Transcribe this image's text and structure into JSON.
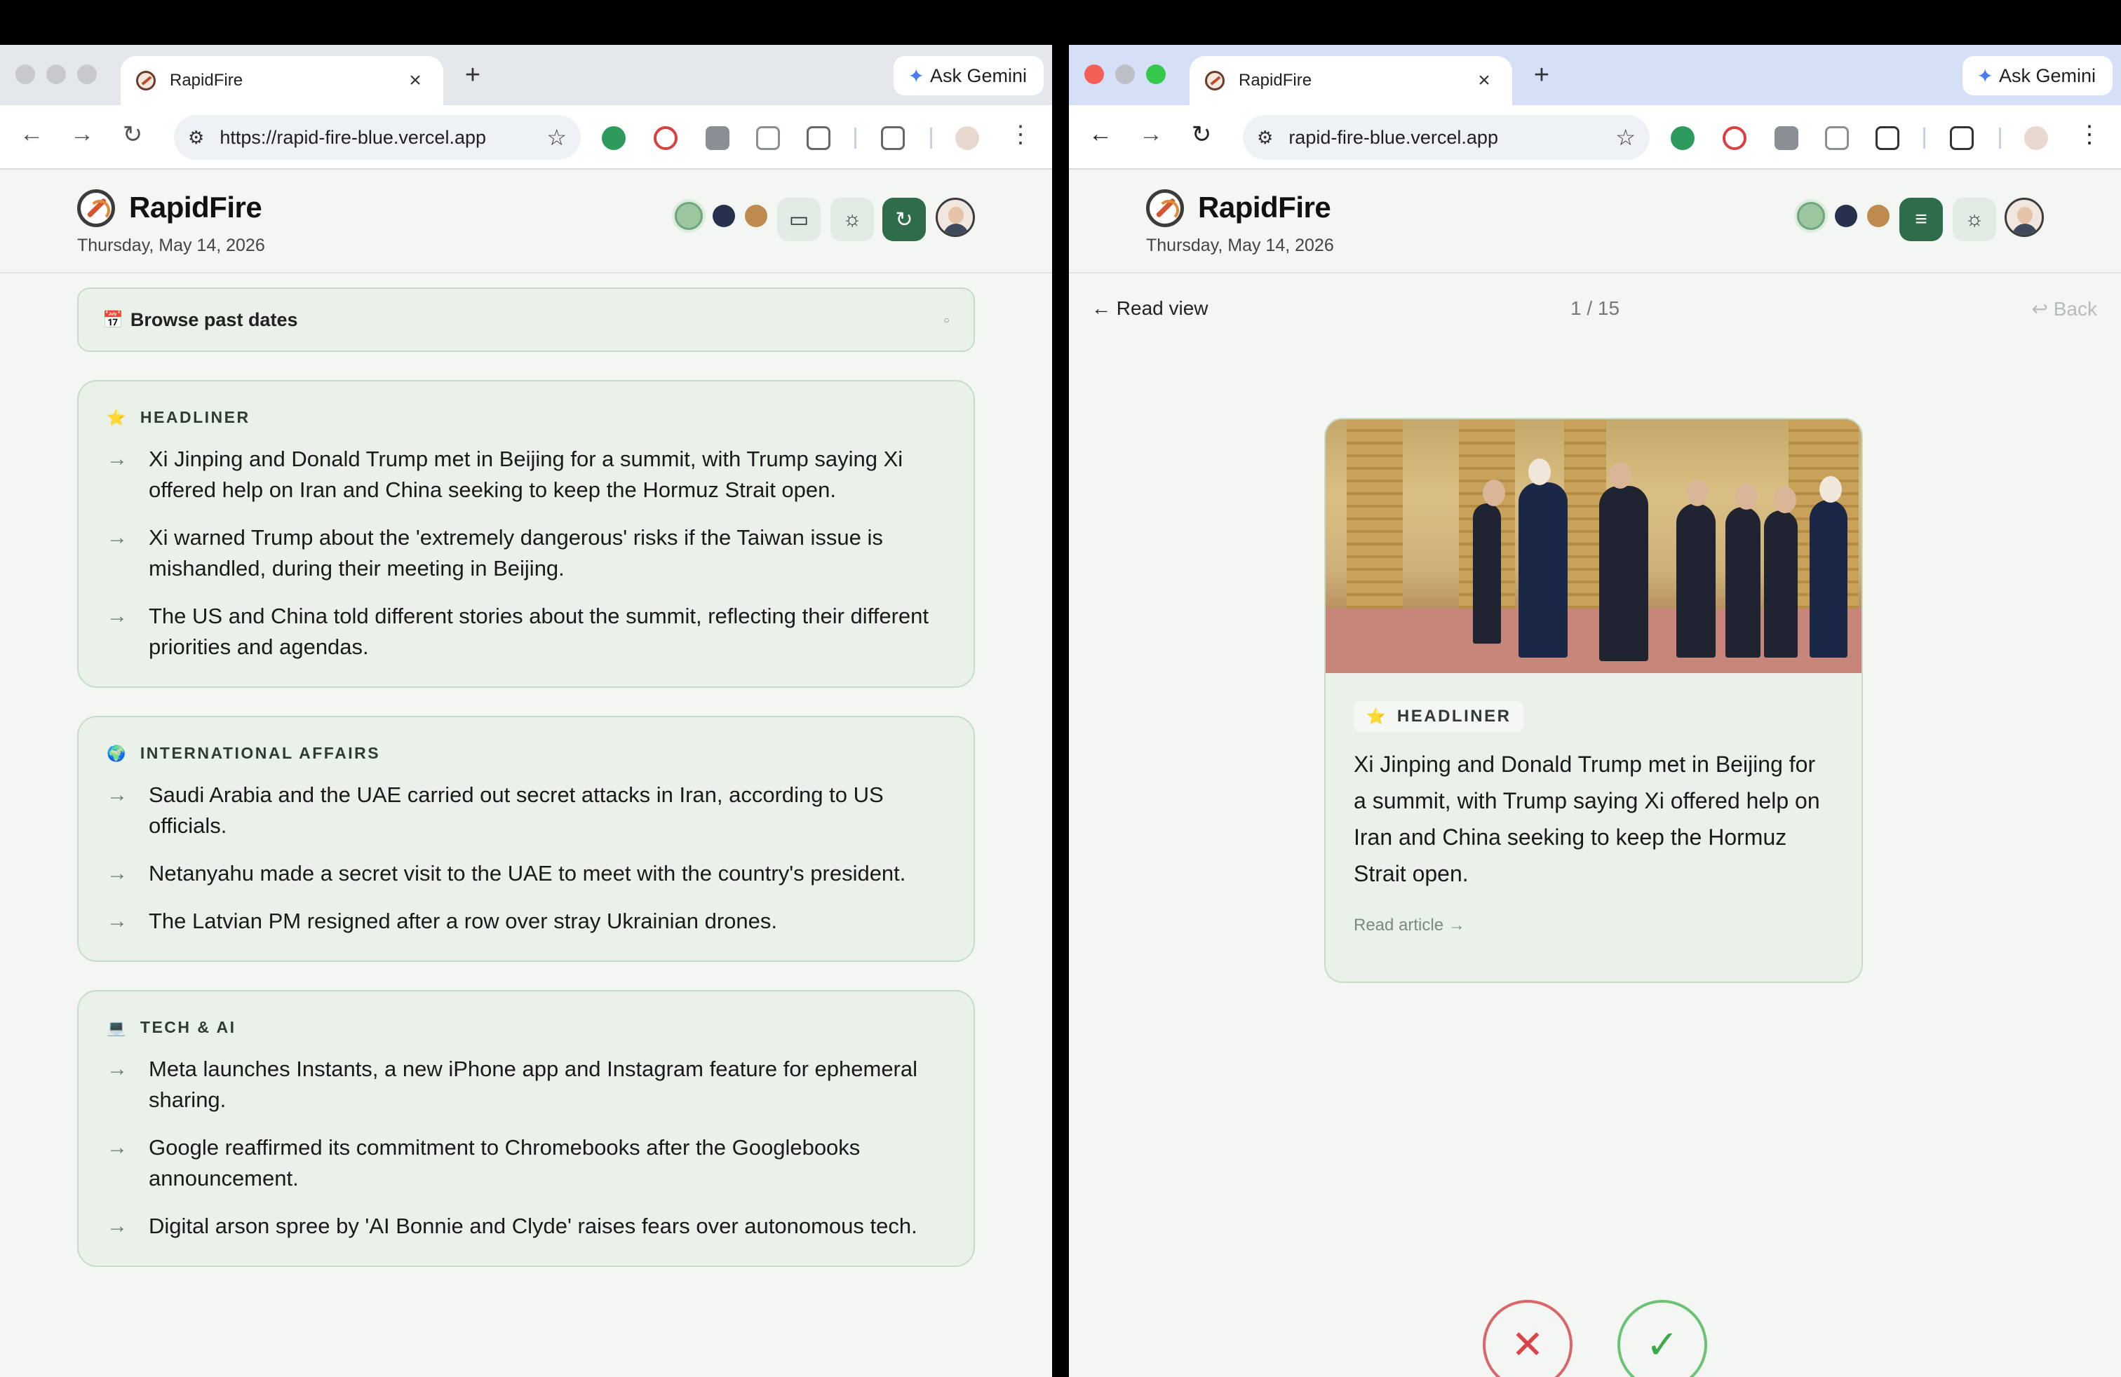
{
  "browser_left": {
    "tab_title": "RapidFire",
    "url": "https://rapid-fire-blue.vercel.app",
    "gemini_label": "Ask Gemini"
  },
  "browser_right": {
    "tab_title": "RapidFire",
    "url": "rapid-fire-blue.vercel.app",
    "gemini_label": "Ask Gemini"
  },
  "app": {
    "brand": "RapidFire",
    "date": "Thursday, May 14, 2026",
    "theme_colors": [
      "#9dc7a1",
      "#26324d",
      "#bf8a4e"
    ]
  },
  "left": {
    "browse_label": "Browse past dates",
    "browse_icon": "calendar-icon",
    "sections": [
      {
        "icon": "⭐",
        "title": "HEADLINER",
        "items": [
          "Xi Jinping and Donald Trump met in Beijing for a summit, with Trump saying Xi offered help on Iran and China seeking to keep the Hormuz Strait open.",
          "Xi warned Trump about the 'extremely dangerous' risks if the Taiwan issue is mishandled, during their meeting in Beijing.",
          "The US and China told different stories about the summit, reflecting their different priorities and agendas."
        ]
      },
      {
        "icon": "🌍",
        "title": "INTERNATIONAL AFFAIRS",
        "items": [
          "Saudi Arabia and the UAE carried out secret attacks in Iran, according to US officials.",
          "Netanyahu made a secret visit to the UAE to meet with the country's president.",
          "The Latvian PM resigned after a row over stray Ukrainian drones."
        ]
      },
      {
        "icon": "💻",
        "title": "TECH & AI",
        "items": [
          "Meta launches Instants, a new iPhone app and Instagram feature for ephemeral sharing.",
          "Google reaffirmed its commitment to Chromebooks after the Googlebooks announcement.",
          "Digital arson spree by 'AI Bonnie and Clyde' raises fears over autonomous tech."
        ]
      }
    ]
  },
  "right": {
    "read_view_label": "← Read view",
    "counter": "1 / 15",
    "back_label": "↩ Back",
    "card": {
      "icon": "⭐",
      "tag": "HEADLINER",
      "text": "Xi Jinping and Donald Trump met in Beijing for a summit, with Trump saying Xi offered help on Iran and China seeking to keep the Hormuz Strait open.",
      "read_article": "Read article →"
    },
    "reject_symbol": "✕",
    "accept_symbol": "✓"
  }
}
